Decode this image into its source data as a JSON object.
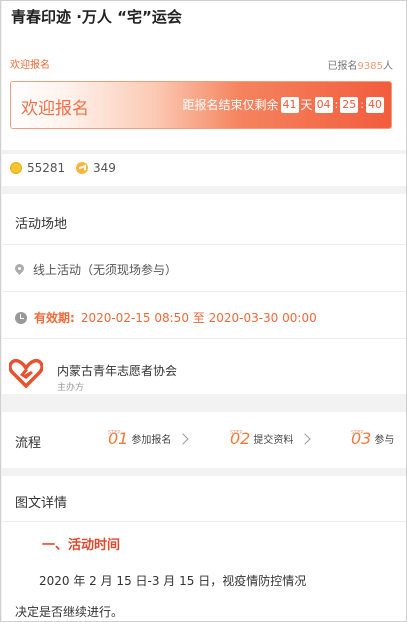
{
  "header": {
    "title": "青春印迹 ·万人 “宅”运会",
    "welcome_small": "欢迎报名",
    "signed_prefix": "已报名",
    "signed_count": "9385",
    "signed_suffix": "人"
  },
  "banner": {
    "title": "欢迎报名",
    "countdown_prefix": "距报名结束仅剩余",
    "days": "41",
    "days_unit": "天",
    "hours": "04",
    "minutes": "25",
    "seconds": "40",
    "sep": ":"
  },
  "stats": {
    "coins": "55281",
    "shares": "349"
  },
  "venue": {
    "title": "活动场地",
    "location": "线上活动（无须现场参与）",
    "valid_label": "有效期:",
    "valid_range": "2020-02-15 08:50 至 2020-03-30 00:00"
  },
  "organizer": {
    "name": "内蒙古青年志愿者协会",
    "role": "主办方"
  },
  "flow": {
    "title": "流程",
    "steps": [
      {
        "num": "01",
        "label": "参加报名"
      },
      {
        "num": "02",
        "label": "提交资料"
      },
      {
        "num": "03",
        "label": "参与"
      }
    ],
    "step_tag": "STEP"
  },
  "details": {
    "title": "图文详情",
    "section_head": "一、活动时间",
    "para_line1": "2020 年 2 月 15 日-3 月 15 日，视疫情防控情况",
    "para_line2": "决定是否继续进行。"
  },
  "colors": {
    "accent": "#ef6a3a",
    "banner_end": "#f25c3c",
    "section_red": "#e0492c"
  }
}
